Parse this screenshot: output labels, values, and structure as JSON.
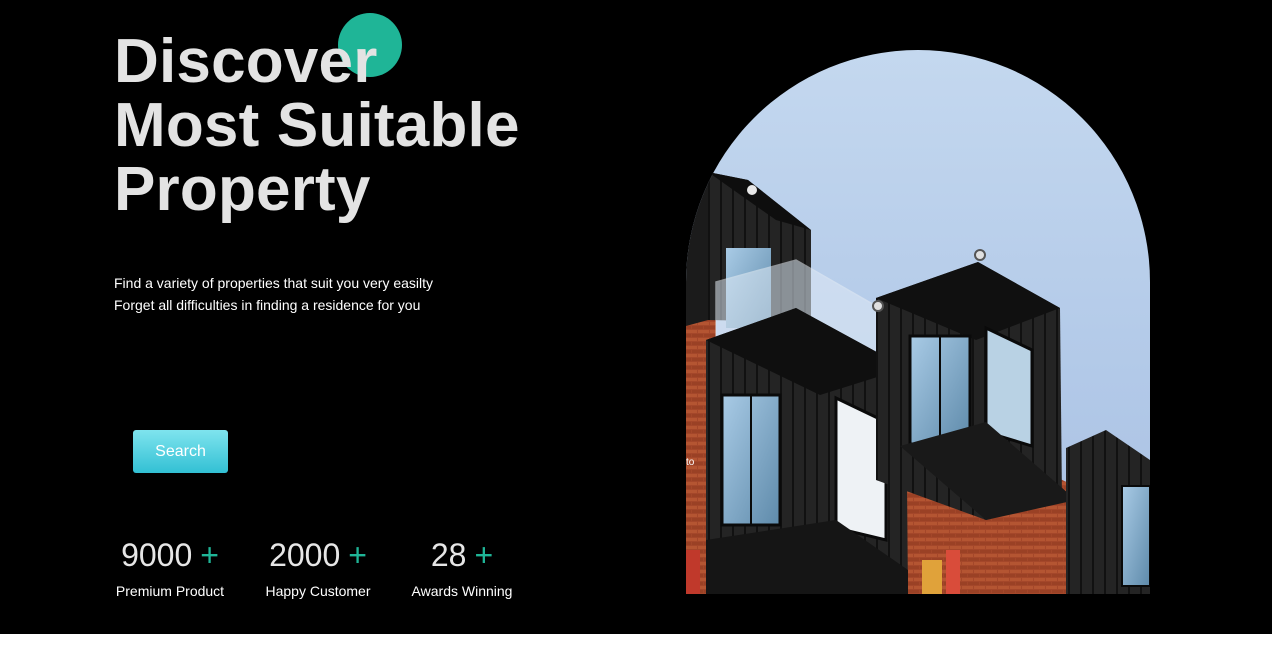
{
  "hero": {
    "title_lines": [
      "Discover",
      "Most Suitable",
      "Property"
    ],
    "subtitle_lines": [
      "Find a variety of properties that suit you very easilty",
      "Forget all difficulties in finding a residence for you"
    ],
    "search_label": "Search",
    "image_caption": "to"
  },
  "stats": [
    {
      "value": "9000",
      "plus": "+",
      "label": "Premium Product"
    },
    {
      "value": "2000",
      "plus": "+",
      "label": "Happy Customer"
    },
    {
      "value": "28",
      "plus": "+",
      "label": "Awards Winning"
    }
  ],
  "colors": {
    "background": "#000000",
    "accent": "#1fb597",
    "button": "#32c0d4",
    "title_text": "#e3e3e3"
  }
}
